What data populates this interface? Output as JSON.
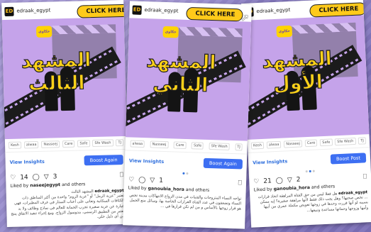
{
  "brand": {
    "cta_color": "#ffca1a",
    "accent": "#3d6ff2",
    "post_bg": "#c5a3ea",
    "title_color": "#ffd21a"
  },
  "cards": [
    {
      "username": "edraak_egypt",
      "cta": "CLICK HERE",
      "logo": "حكاوي",
      "title_line1": "المشهد",
      "title_line2": "الثالث",
      "partners": [
        "Kesh",
        "alwaa",
        "Nasseej",
        "Care",
        "Safe",
        "Sfe Wash",
        "TJ"
      ],
      "insights": "View Insights",
      "boost": "Boost Again",
      "likes_count": "14",
      "shares_count": "3",
      "liked_by_user": "naseejegypt",
      "liked_by_text": "Liked by",
      "and_others": "and others",
      "caption_user": "edraak_egypt",
      "caption_title": "المشهد الثالث",
      "caption_body": "تعتبر \"عزبة الرمل\" أو \"عزبة الروم\" واحدة من أكثر المناطق ذات الكثافات السكانية وتعاني على أعتاب الستار في غرف المطيرات، فهي عبارة عن عزبة صغيرة تجرب الحماية للعالم في نماذج وظائف ولا بد يعتبر من التطبيق الرسمي، بندوسول الزواج. ومع إجراء تنفيذ الاتفاق ينتج من أي دليل حلي."
    },
    {
      "username": "edraak_egypt",
      "cta": "CLICK HERE",
      "logo": "حكاوي",
      "title_line1": "المشهد",
      "title_line2": "الثاني",
      "partners": [
        "alwaa",
        "Nasseej",
        "Care",
        "Safe",
        "Sfe Wash",
        "TJ"
      ],
      "insights": "View Insights",
      "boost": "Boost Again",
      "likes_count": "",
      "shares_count": "1",
      "liked_by_user": "ganoubia_hora",
      "liked_by_text": "Liked by",
      "and_others": "and others",
      "caption_user": "",
      "caption_title": "",
      "caption_body": "تواجه النساء المتزوجات والفتيات في مدن الزواج الانتهاكات مدينة تخص النساء وتضعفون في عدد الفتاة القرارات الخاصة بها، وسائل منع الحمل هو قرار زوجها بالأساس و من لم تكن قرارها في ..."
    },
    {
      "username": "edraak_egypt",
      "cta": "CLICK HERE",
      "logo": "حكاوي",
      "title_line1": "المشهد",
      "title_line2": "الأول",
      "partners": [
        "Kesh",
        "alwaa",
        "Nasseej",
        "Care",
        "Safe",
        "Sfe Wash",
        "TJ"
      ],
      "insights": "View Insights",
      "boost": "Boost Post",
      "likes_count": "21",
      "shares_count": "2",
      "liked_by_user": "ganoubia_hora",
      "liked_by_text": "Liked by",
      "and_others": "and others",
      "caption_user": "edraak_egypt",
      "caption_title": "",
      "caption_body": "هل فعلا ليس من حق الفتاة المراهقة اتخاذ قرارات ... تخص صحتها؟ وهل يجب ذلك فقط لأنها مراهقة صغيرة؟ إيه ممكن يسببه لو أنها قررت وحدها في زوجها تعويض مكملة عمري بين أبيها وأمها وزوجها وحماتها مساعدة وتبيعها..."
    }
  ]
}
